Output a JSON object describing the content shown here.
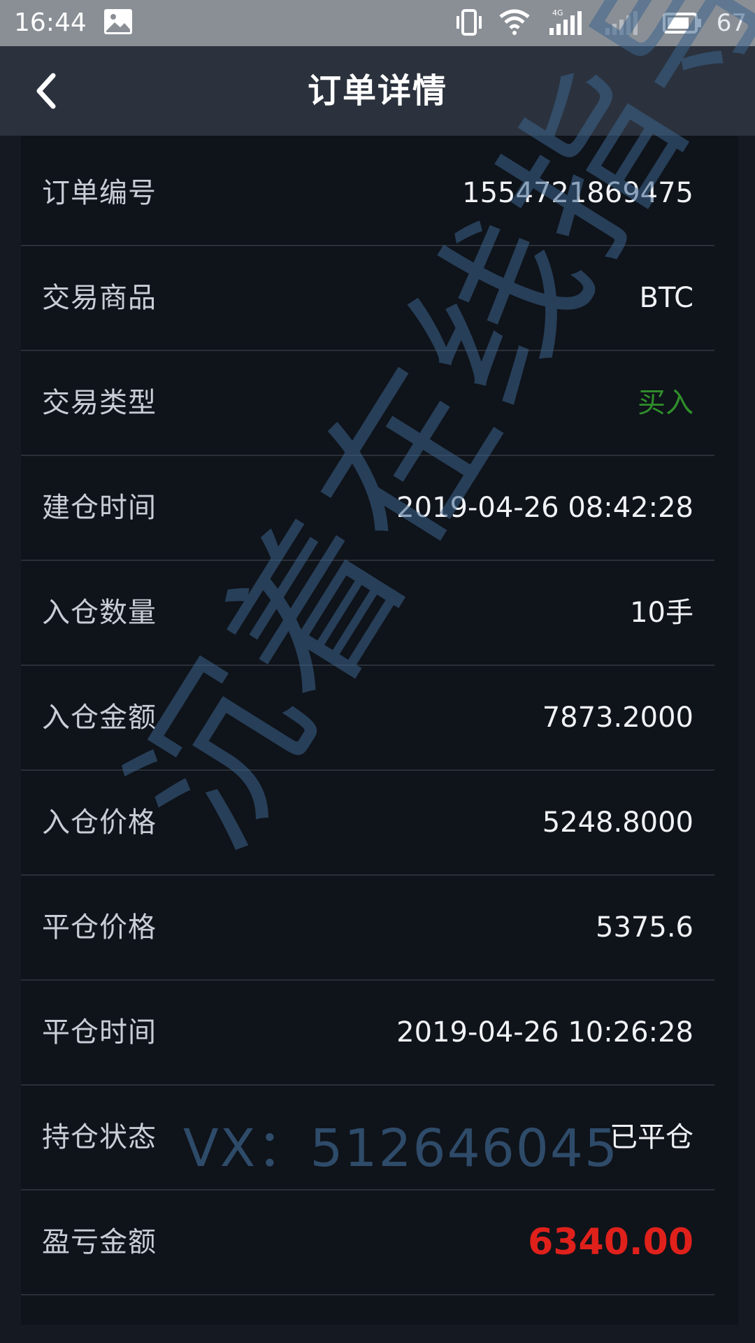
{
  "status_bar": {
    "time": "16:44",
    "right_text": "67"
  },
  "nav": {
    "title": "订单详情"
  },
  "rows": [
    {
      "label": "订单编号",
      "value": "1554721869475"
    },
    {
      "label": "交易商品",
      "value": "BTC"
    },
    {
      "label": "交易类型",
      "value": "买入"
    },
    {
      "label": "建仓时间",
      "value": "2019-04-26 08:42:28"
    },
    {
      "label": "入仓数量",
      "value": "10手"
    },
    {
      "label": "入仓金额",
      "value": "7873.2000"
    },
    {
      "label": "入仓价格",
      "value": "5248.8000"
    },
    {
      "label": "平仓价格",
      "value": "5375.6"
    },
    {
      "label": "平仓时间",
      "value": "2019-04-26 10:26:28"
    },
    {
      "label": "持仓状态",
      "value": "已平仓"
    },
    {
      "label": "盈亏金额",
      "value": "6340.00"
    }
  ],
  "watermark": {
    "text": "沉着在线指导",
    "vx": "VX：512646045"
  },
  "colors": {
    "buy": "#2f8f2a",
    "pnl": "#e0211b",
    "nav_bg": "#2b323d",
    "status_bg": "#8a8f96"
  }
}
